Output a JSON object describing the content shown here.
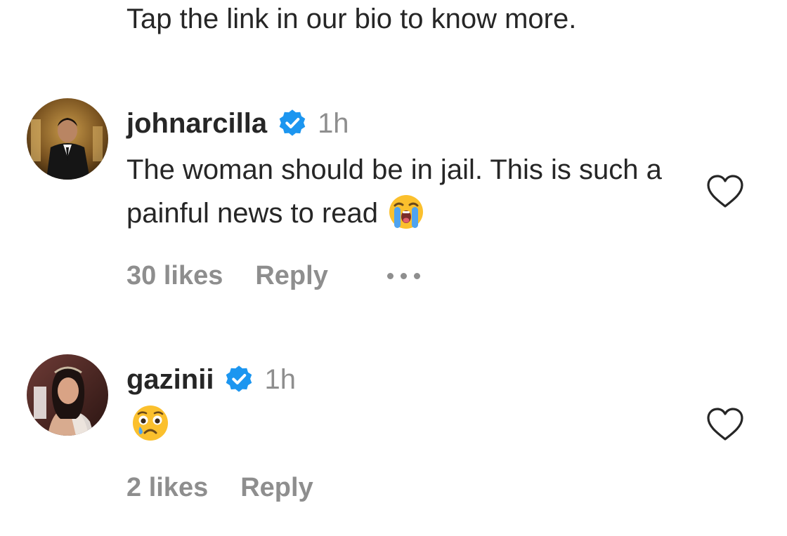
{
  "caption": "Tap the link in our bio to know more.",
  "colors": {
    "text": "#262626",
    "muted": "#8e8e8e",
    "verified_blue": "#1c96f0"
  },
  "comments": [
    {
      "username": "johnarcilla",
      "verified": true,
      "time": "1h",
      "text": "The woman should be in jail. This is such a painful news to read",
      "emoji": "loudly-crying-face",
      "likes": "30 likes",
      "reply_label": "Reply",
      "has_more_menu": true,
      "like_icon": "heart-outline-icon"
    },
    {
      "username": "gazinii",
      "verified": true,
      "time": "1h",
      "text": "",
      "emoji": "anguished-crying-face",
      "likes": "2 likes",
      "reply_label": "Reply",
      "has_more_menu": false,
      "like_icon": "heart-outline-icon"
    }
  ]
}
